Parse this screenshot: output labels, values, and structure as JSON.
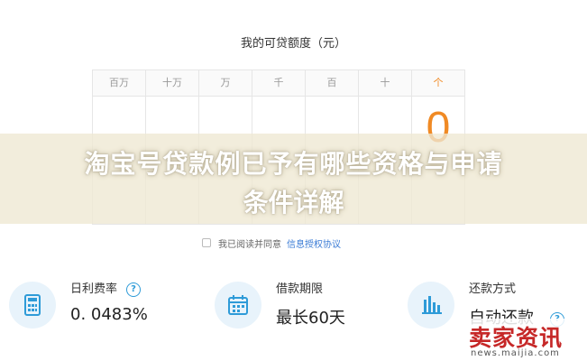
{
  "title": "我的可贷额度（元）",
  "digit_headers": [
    "百万",
    "十万",
    "万",
    "千",
    "百",
    "十",
    "个"
  ],
  "active_digit_index": 6,
  "amount_digit": "0",
  "banner": {
    "line1": "淘宝号贷款例已予有哪些资格与申请",
    "line2": "条件详解"
  },
  "agreement": {
    "text": "我已阅读并同意",
    "link": "信息授权协议"
  },
  "info_cards": [
    {
      "label": "日利费率",
      "value": "0. 0483%",
      "icon": "calculator-icon",
      "help": "?"
    },
    {
      "label": "借款期限",
      "value": "最长60天",
      "icon": "calendar-icon"
    },
    {
      "label": "还款方式",
      "value": "自动还款",
      "icon": "bar-chart-icon",
      "help": "?"
    }
  ],
  "watermark": {
    "main": "卖家资讯",
    "url": "news.maijia.com"
  },
  "colors": {
    "accent_orange": "#f08a24",
    "accent_blue": "#2e9bd8",
    "link_blue": "#3a7bd5"
  }
}
